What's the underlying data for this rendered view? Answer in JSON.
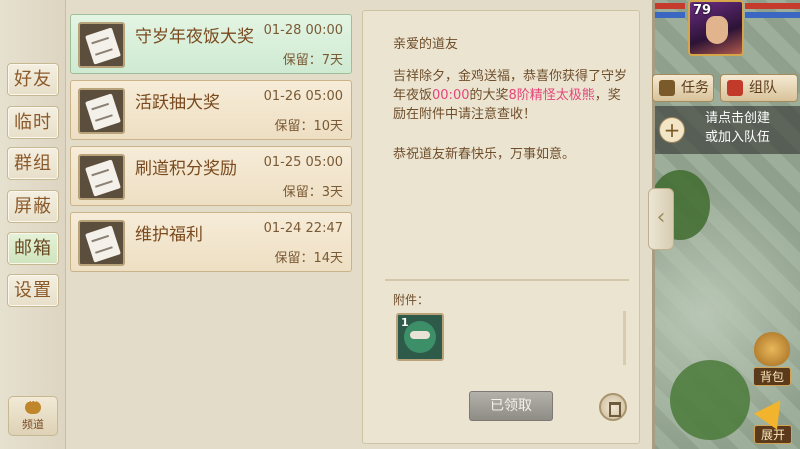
{
  "tabs": [
    {
      "label": "好友"
    },
    {
      "label": "临时"
    },
    {
      "label": "群组"
    },
    {
      "label": "屏蔽"
    },
    {
      "label": "邮箱"
    },
    {
      "label": "设置"
    }
  ],
  "active_tab": "邮箱",
  "channel_label": "频道",
  "mails": [
    {
      "title": "守岁年夜饭大奖",
      "date": "01-28 00:00",
      "keep": "保留：7天"
    },
    {
      "title": "活跃抽大奖",
      "date": "01-26 05:00",
      "keep": "保留：10天"
    },
    {
      "title": "刷道积分奖励",
      "date": "01-25 05:00",
      "keep": "保留：3天"
    },
    {
      "title": "维护福利",
      "date": "01-24 22:47",
      "keep": "保留：14天"
    }
  ],
  "content": {
    "greeting": "亲爱的道友",
    "body_1": "吉祥除夕，金鸡送福，恭喜你获得了守岁年夜饭",
    "body_time": "00:00",
    "body_2": "的大奖",
    "body_item": "8阶精怪太极熊",
    "body_3": "，奖励在附件中请注意查收！",
    "closing": "恭祝道友新春快乐，万事如意。",
    "attachment_label": "附件：",
    "attachment_count": "1",
    "claim_button": "已领取",
    "highlight_color": "#e5457a"
  },
  "hud": {
    "level": "79",
    "task_label": "任务",
    "team_label": "组队",
    "team_hint_1": "请点击创建",
    "team_hint_2": "或加入队伍",
    "bag_label": "背包",
    "expand_label": "展开",
    "plus": "+"
  }
}
